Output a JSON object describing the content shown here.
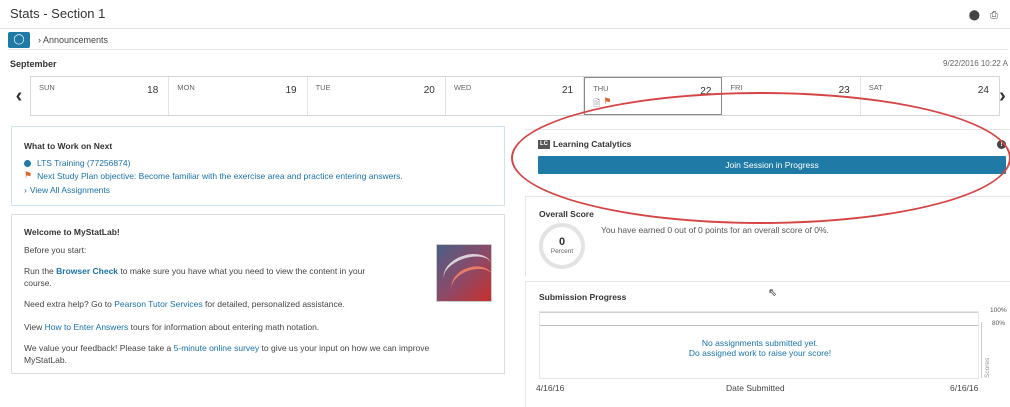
{
  "header": {
    "title": "Stats - Section 1",
    "icons": [
      "info-icon",
      "print-icon"
    ]
  },
  "announcements": {
    "label": "Announcements"
  },
  "calendar": {
    "month": "September",
    "datetime": "9/22/2016 10:22 A",
    "days": [
      {
        "name": "SUN",
        "date": "18"
      },
      {
        "name": "MON",
        "date": "19"
      },
      {
        "name": "TUE",
        "date": "20"
      },
      {
        "name": "WED",
        "date": "21"
      },
      {
        "name": "THU",
        "date": "22"
      },
      {
        "name": "FRI",
        "date": "23"
      },
      {
        "name": "SAT",
        "date": "24"
      }
    ],
    "today_index": 4
  },
  "what_to_work_on": {
    "title": "What to Work on Next",
    "item1": "LTS Training (77256874)",
    "item2": "Next Study Plan objective: Become familiar with the exercise area and practice entering answers.",
    "view_all": "View All Assignments"
  },
  "welcome": {
    "title": "Welcome to MyStatLab!",
    "before": "Before you start:",
    "p1_pre": "Run the ",
    "p1_link": "Browser Check",
    "p1_post": " to make sure you have what you need to view the content in your",
    "p1_line2": "course.",
    "p2_pre": "Need extra help? Go to ",
    "p2_link": "Pearson Tutor Services",
    "p2_post": " for detailed, personalized assistance.",
    "p3_pre": "View ",
    "p3_link": "How to Enter Answers",
    "p3_post": " tours for information about entering math notation.",
    "p4_pre": "We value your feedback! Please take a ",
    "p4_link": "5-minute online survey",
    "p4_post": " to give us your input on how we can improve",
    "p4_line2": "MyStatLab."
  },
  "learning_catalytics": {
    "logo": "LC",
    "title": "Learning Catalytics",
    "button": "Join Session in Progress"
  },
  "overall_score": {
    "title": "Overall Score",
    "value": "0",
    "unit": "Percent",
    "text": "You have earned 0 out of 0 points for an overall score of 0%."
  },
  "submission_progress": {
    "title": "Submission Progress",
    "y100": "100%",
    "y80": "80%",
    "y_title": "Scores",
    "empty1": "No assignments submitted yet.",
    "empty2": "Do assigned work to raise your score!",
    "x_start": "4/16/16",
    "x_title": "Date Submitted",
    "x_end": "6/16/16"
  },
  "colors": {
    "accent": "#1f7aa6",
    "pin": "#d9632a",
    "annotation": "#d64545"
  }
}
